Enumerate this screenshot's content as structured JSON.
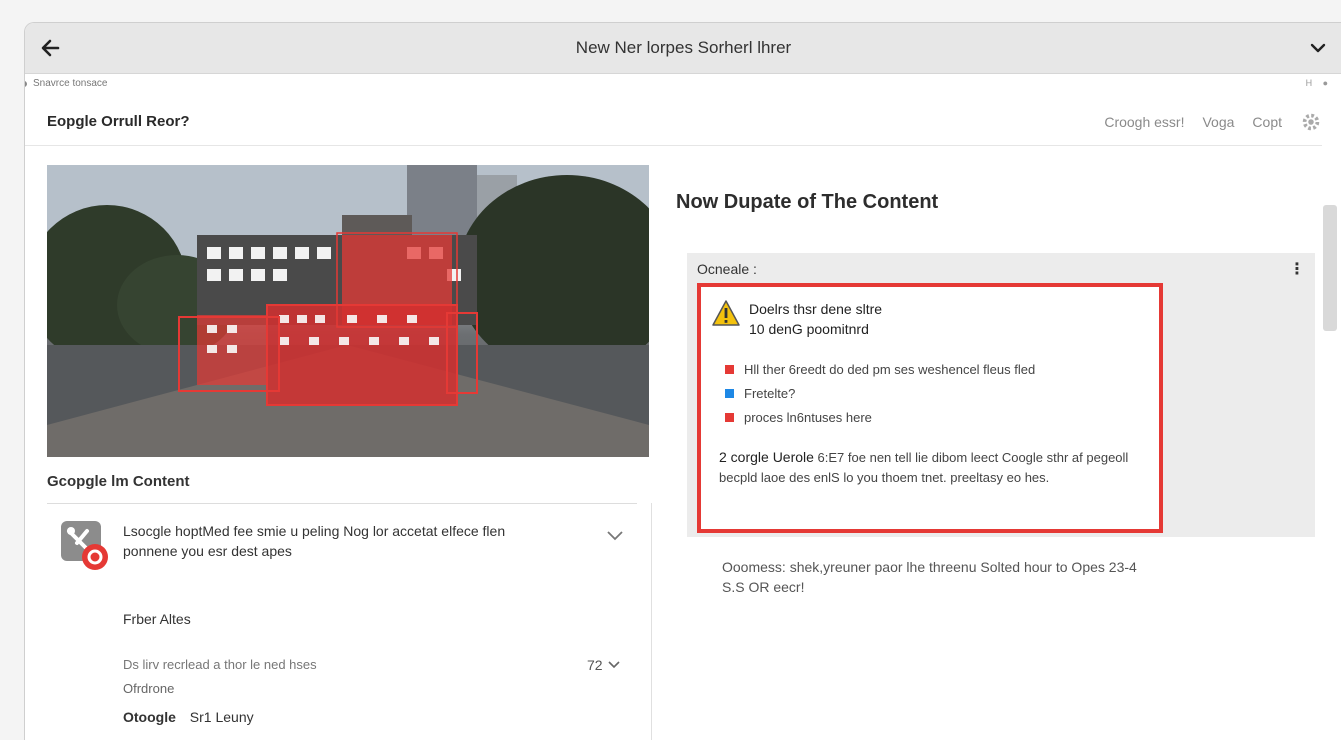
{
  "window": {
    "title": "New Ner lorpes Sorherl lhrer"
  },
  "subbar": {
    "crumb": "Snavrce tonsace",
    "right": "H  ●"
  },
  "header": {
    "page_title": "Eopgle Orrull Reor?",
    "links": [
      "Croogh essr!",
      "Voga",
      "Copt"
    ]
  },
  "left": {
    "section_title": "Gcopgle lm Content",
    "card_text": "Lsocgle hoptMed fee smie u peling Nog lor accetat elfece flen ponnene you esr dest apes",
    "subsection_title": "Frber Altes",
    "row_text": "Ds lirv recrlead a thor le ned hses",
    "row_sub": "Ofrdrone",
    "row_count": "72",
    "row_user_name": "Otoogle",
    "row_user_value": "Sr1 Leuny"
  },
  "right": {
    "title": "Now Dupate of The Content",
    "panel_label": "Ocneale :",
    "warning_line1": "Doelrs thsr dene sltre",
    "warning_line2": "10 denG poomitnrd",
    "bullets": [
      {
        "text": "Hll ther 6reedt do ded pm ses weshencel fleus fled",
        "color": "#e53935"
      },
      {
        "text": "Fretelte?",
        "color": "#1e88e5"
      },
      {
        "text": "proces ln6ntuses here",
        "color": "#e53935"
      }
    ],
    "paragraph_lead": "2 corgle Uerole",
    "paragraph_rest": " 6:E7 foe nen tell lie dibom leect Coogle sthr af pegeoll becpld laoe des enlS lo you thoem tnet. preeltasy eo hes.",
    "below_text": "Ooomess: shek,yreuner paor lhe threenu Solted hour to Opes 23-4 S.S OR eecr!"
  },
  "colors": {
    "accent_red": "#e53935",
    "accent_blue": "#1e88e5",
    "warning_yellow": "#f4c20d"
  }
}
